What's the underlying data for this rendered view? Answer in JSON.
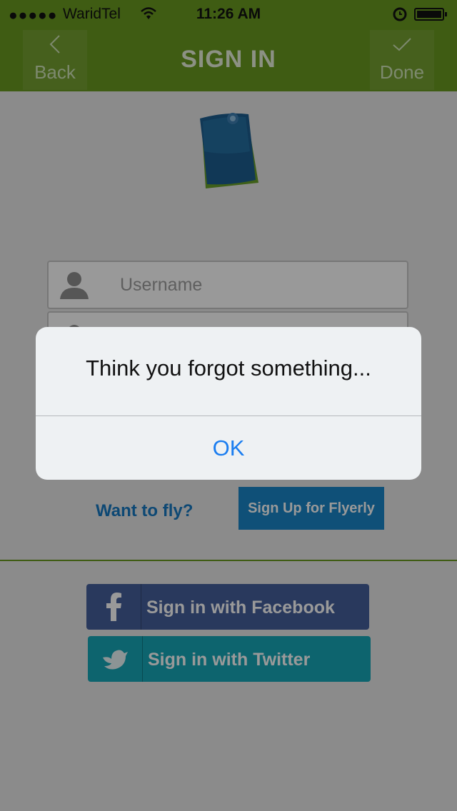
{
  "status_bar": {
    "signal": "●●●●●",
    "carrier": "WaridTel",
    "time": "11:26 AM"
  },
  "nav": {
    "back_label": "Back",
    "title": "SIGN IN",
    "done_label": "Done"
  },
  "form": {
    "username_placeholder": "Username"
  },
  "signup": {
    "prompt": "Want to fly?",
    "button_label": "Sign Up for Flyerly"
  },
  "social": {
    "facebook_label": "Sign in with Facebook",
    "twitter_label": "Sign in with Twitter"
  },
  "alert": {
    "message": "Think you forgot something...",
    "ok_label": "OK"
  },
  "colors": {
    "brand_green": "#6a9a20",
    "facebook": "#45609b",
    "twitter": "#16a7b7",
    "accent_blue": "#1a86c8"
  }
}
